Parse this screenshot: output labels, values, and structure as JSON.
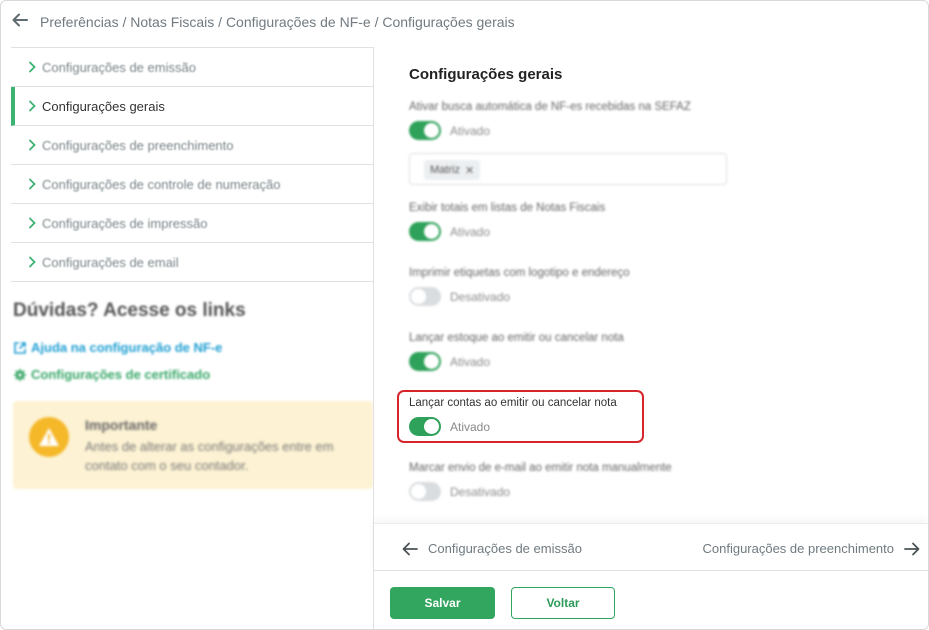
{
  "header": {
    "breadcrumb": "Preferências / Notas Fiscais / Configurações de NF-e / Configurações gerais"
  },
  "sidebar": {
    "items": [
      {
        "label": "Configurações de emissão",
        "active": false
      },
      {
        "label": "Configurações gerais",
        "active": true
      },
      {
        "label": "Configurações de preenchimento",
        "active": false
      },
      {
        "label": "Configurações de controle de numeração",
        "active": false
      },
      {
        "label": "Configurações de impressão",
        "active": false
      },
      {
        "label": "Configurações de email",
        "active": false
      }
    ],
    "help_title": "Dúvidas? Acesse os links",
    "links": [
      {
        "label": "Ajuda na configuração de NF-e",
        "icon": "external-link-icon"
      },
      {
        "label": "Configurações de certificado",
        "icon": "gear-icon"
      }
    ],
    "notice": {
      "icon": "warning-icon",
      "title": "Importante",
      "body": "Antes de alterar as configurações entre em contato com o seu contador."
    }
  },
  "main": {
    "title": "Configurações gerais",
    "settings": [
      {
        "label": "Ativar busca automática de NF-es recebidas na SEFAZ",
        "state": "Ativado",
        "on": true
      },
      {
        "label": "Exibir totais em listas de Notas Fiscais",
        "state": "Ativado",
        "on": true
      },
      {
        "label": "Imprimir etiquetas com logotipo e endereço",
        "state": "Desativado",
        "on": false
      },
      {
        "label": "Lançar estoque ao emitir ou cancelar nota",
        "state": "Ativado",
        "on": true
      },
      {
        "label": "Lançar contas ao emitir ou cancelar nota",
        "state": "Ativado",
        "on": true
      },
      {
        "label": "Marcar envio de e-mail ao emitir nota manualmente",
        "state": "Desativado",
        "on": false
      }
    ],
    "chip": {
      "label": "Matriz",
      "remove": "✕"
    },
    "nav": {
      "prev": "Configurações de emissão",
      "next": "Configurações de preenchimento"
    },
    "buttons": {
      "save": "Salvar",
      "back": "Voltar"
    }
  },
  "colors": {
    "accent": "#32a55f",
    "highlight": "#d6262b",
    "notice_bg": "#fdf2d3",
    "warning": "#f5b829",
    "link": "#1f9fd3"
  }
}
